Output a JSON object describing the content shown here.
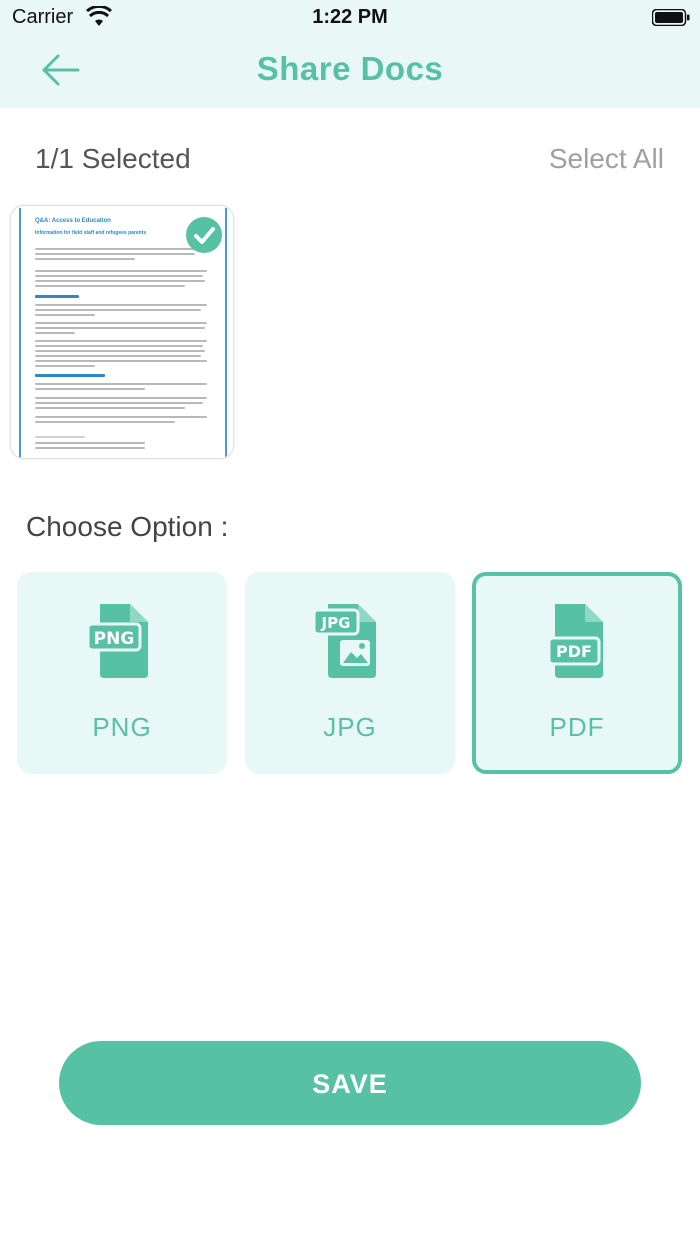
{
  "status_bar": {
    "carrier": "Carrier",
    "time": "1:22 PM"
  },
  "header": {
    "title": "Share Docs"
  },
  "selection": {
    "count_label": "1/1 Selected",
    "select_all_label": "Select All"
  },
  "document_thumbnail": {
    "heading": "Q&A: Access to Education",
    "subheading": "Information for field staff and refugees parents",
    "selected": true
  },
  "options": {
    "title": "Choose Option :",
    "items": [
      {
        "label": "PNG",
        "icon": "png-file-icon",
        "selected": false
      },
      {
        "label": "JPG",
        "icon": "jpg-file-icon",
        "selected": false
      },
      {
        "label": "PDF",
        "icon": "pdf-file-icon",
        "selected": true
      }
    ]
  },
  "save_button": {
    "label": "SAVE"
  },
  "colors": {
    "accent": "#57c2a3",
    "header_bg": "#e9f8f7",
    "option_bg": "#e8f8f7"
  }
}
